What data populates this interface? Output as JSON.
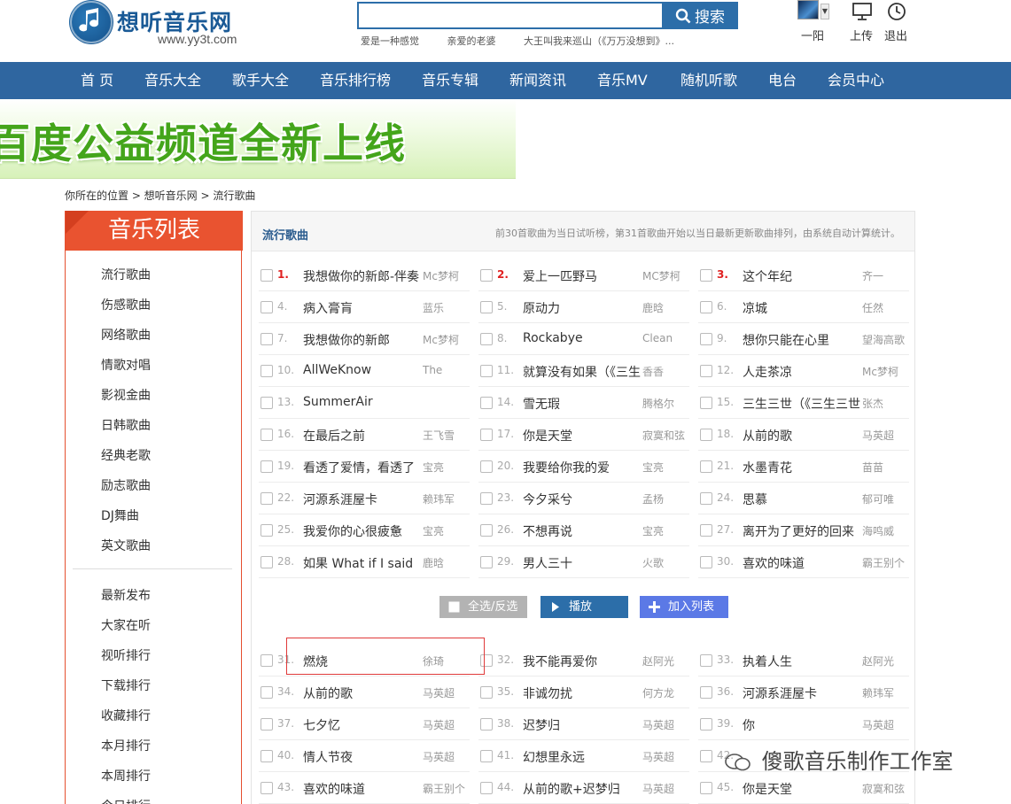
{
  "logo": {
    "title": "想听音乐网",
    "url": "www.yy3t.com"
  },
  "search": {
    "placeholder": "",
    "button_label": "搜索",
    "hotwords": [
      "爱是一种感觉",
      "亲爱的老婆",
      "大王叫我来巡山（《万万没想到》..."
    ]
  },
  "user": {
    "name": "一阳",
    "upload_label": "上传",
    "logout_label": "退出"
  },
  "nav": [
    "首 页",
    "音乐大全",
    "歌手大全",
    "音乐排行榜",
    "音乐专辑",
    "新闻资讯",
    "音乐MV",
    "随机听歌",
    "电台",
    "会员中心"
  ],
  "banner": {
    "text": "百度公益频道全新上线"
  },
  "breadcrumb": "你所在的位置 > 想听音乐网 > 流行歌曲",
  "sidebar": {
    "title": "音乐列表",
    "group1": [
      "流行歌曲",
      "伤感歌曲",
      "网络歌曲",
      "情歌对唱",
      "影视金曲",
      "日韩歌曲",
      "经典老歌",
      "励志歌曲",
      "DJ舞曲",
      "英文歌曲"
    ],
    "group2": [
      "最新发布",
      "大家在听",
      "视听排行",
      "下载排行",
      "收藏排行",
      "本月排行",
      "本周排行",
      "今日排行"
    ]
  },
  "panel": {
    "title": "流行歌曲",
    "note": "前30首歌曲为当日试听榜，第31首歌曲开始以当日最新更新歌曲排列，由系统自动计算统计。"
  },
  "songs_top": [
    {
      "num": "1.",
      "title": "我想做你的新郎-伴奏",
      "artist": "Mc梦柯"
    },
    {
      "num": "2.",
      "title": "爱上一匹野马",
      "artist": "MC梦柯"
    },
    {
      "num": "3.",
      "title": "这个年纪",
      "artist": "齐一"
    },
    {
      "num": "4.",
      "title": "病入膏肓",
      "artist": "蓝乐"
    },
    {
      "num": "5.",
      "title": "原动力",
      "artist": "鹿晗"
    },
    {
      "num": "6.",
      "title": "凉城",
      "artist": "任然"
    },
    {
      "num": "7.",
      "title": "我想做你的新郎",
      "artist": "Mc梦柯"
    },
    {
      "num": "8.",
      "title": "Rockabye",
      "artist": "Clean"
    },
    {
      "num": "9.",
      "title": "想你只能在心里",
      "artist": "望海高歌"
    },
    {
      "num": "10.",
      "title": "AllWeKnow",
      "artist": "The"
    },
    {
      "num": "11.",
      "title": "就算没有如果（《三生",
      "artist": "香香"
    },
    {
      "num": "12.",
      "title": "人走茶凉",
      "artist": "Mc梦柯"
    },
    {
      "num": "13.",
      "title": "SummerAir",
      "artist": ""
    },
    {
      "num": "14.",
      "title": "雪无瑕",
      "artist": "腾格尔"
    },
    {
      "num": "15.",
      "title": "三生三世（《三生三世",
      "artist": "张杰"
    },
    {
      "num": "16.",
      "title": "在最后之前",
      "artist": "王飞雪"
    },
    {
      "num": "17.",
      "title": "你是天堂",
      "artist": "寂寞和弦"
    },
    {
      "num": "18.",
      "title": "从前的歌",
      "artist": "马英超"
    },
    {
      "num": "19.",
      "title": "看透了爱情，看透了",
      "artist": "宝亮"
    },
    {
      "num": "20.",
      "title": "我要给你我的爱",
      "artist": "宝亮"
    },
    {
      "num": "21.",
      "title": "水墨青花",
      "artist": "苗苗"
    },
    {
      "num": "22.",
      "title": "河源系涯屋卡",
      "artist": "赖玮军"
    },
    {
      "num": "23.",
      "title": "今夕采兮",
      "artist": "孟杨"
    },
    {
      "num": "24.",
      "title": "思慕",
      "artist": "郁可唯"
    },
    {
      "num": "25.",
      "title": "我爱你的心很疲惫",
      "artist": "宝亮"
    },
    {
      "num": "26.",
      "title": "不想再说",
      "artist": "宝亮"
    },
    {
      "num": "27.",
      "title": "离开为了更好的回来",
      "artist": "海鸣威"
    },
    {
      "num": "28.",
      "title": "如果 What if I said",
      "artist": "鹿晗"
    },
    {
      "num": "29.",
      "title": "男人三十",
      "artist": "火歌"
    },
    {
      "num": "30.",
      "title": "喜欢的味道",
      "artist": "霸王别个"
    }
  ],
  "buttons": {
    "select_all": "全选/反选",
    "play": "播放",
    "add_list": "加入列表"
  },
  "songs_new": [
    {
      "num": "31.",
      "title": "燃烧",
      "artist": "徐琦"
    },
    {
      "num": "32.",
      "title": "我不能再爱你",
      "artist": "赵阿光"
    },
    {
      "num": "33.",
      "title": "执着人生",
      "artist": "赵阿光"
    },
    {
      "num": "34.",
      "title": "从前的歌",
      "artist": "马英超"
    },
    {
      "num": "35.",
      "title": "非诚勿扰",
      "artist": "何方龙"
    },
    {
      "num": "36.",
      "title": "河源系涯屋卡",
      "artist": "赖玮军"
    },
    {
      "num": "37.",
      "title": "七夕忆",
      "artist": "马英超"
    },
    {
      "num": "38.",
      "title": "迟梦归",
      "artist": "马英超"
    },
    {
      "num": "39.",
      "title": "你",
      "artist": "马英超"
    },
    {
      "num": "40.",
      "title": "情人节夜",
      "artist": "马英超"
    },
    {
      "num": "41.",
      "title": "幻想里永远",
      "artist": "马英超"
    },
    {
      "num": "42.",
      "title": "",
      "artist": ""
    },
    {
      "num": "43.",
      "title": "喜欢的味道",
      "artist": "霸王别个"
    },
    {
      "num": "44.",
      "title": "从前的歌+迟梦归",
      "artist": "马英超"
    },
    {
      "num": "45.",
      "title": "你是天堂",
      "artist": "寂寞和弦"
    }
  ],
  "watermark": "傻歌音乐制作工作室",
  "colors": {
    "nav": "#2f66a0",
    "accent_red": "#e95330",
    "highlight_border": "#e03a3a"
  }
}
